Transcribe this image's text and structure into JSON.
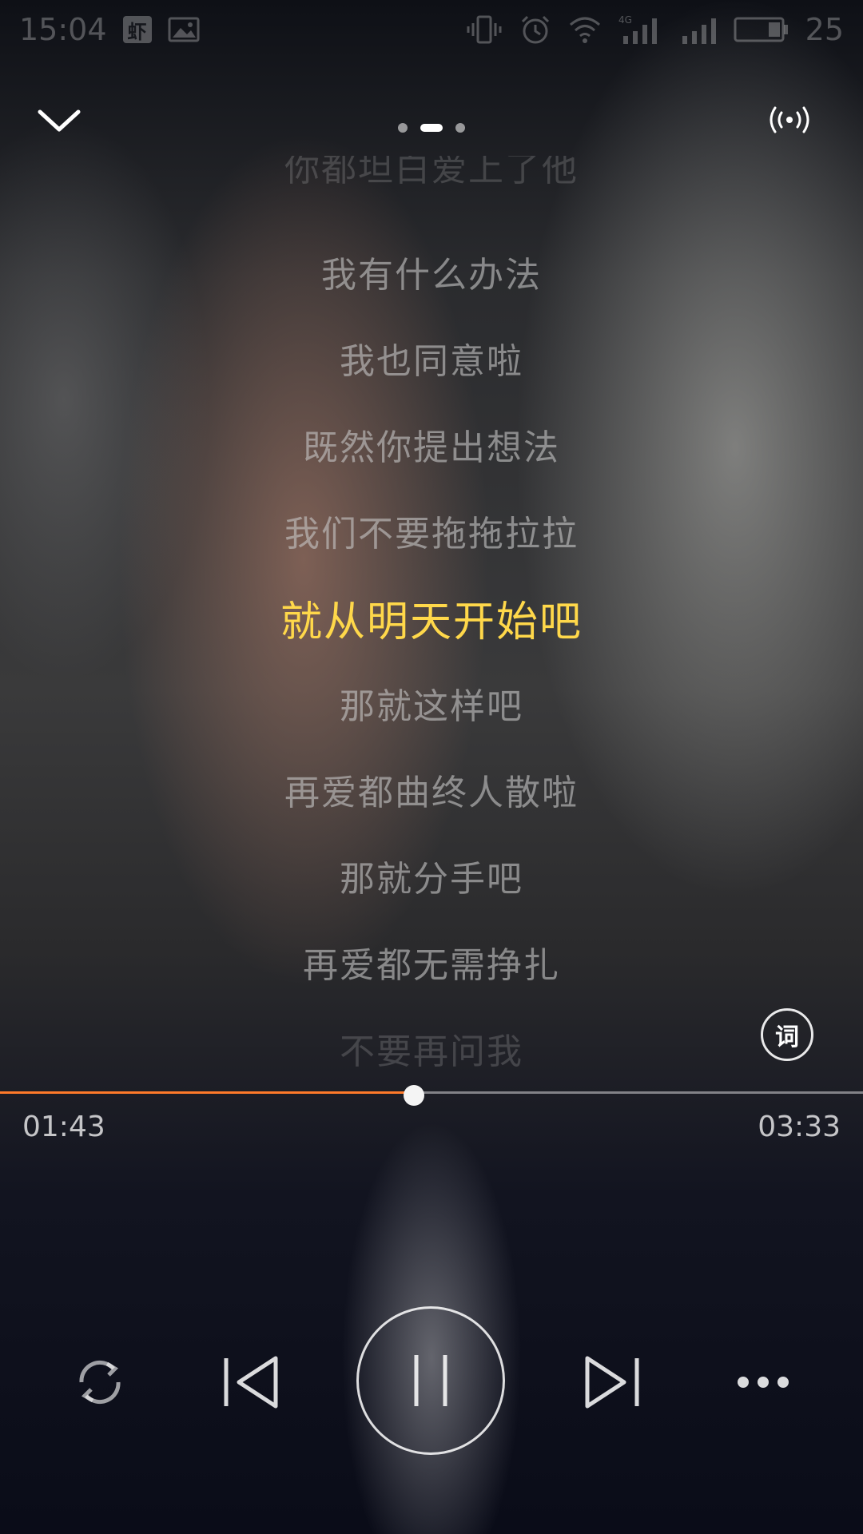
{
  "status_bar": {
    "time": "15:04",
    "app_badge": "虾",
    "battery": "25",
    "network": "4G"
  },
  "top_bar": {
    "collapse_icon": "chevron-down-icon",
    "page_dots": 3,
    "active_page": 2,
    "cast_icon": "broadcast-icon"
  },
  "lyrics": {
    "lines": [
      "你都坦白爱上了他",
      "我有什么办法",
      "我也同意啦",
      "既然你提出想法",
      "我们不要拖拖拉拉",
      "就从明天开始吧",
      "那就这样吧",
      "再爱都曲终人散啦",
      "那就分手吧",
      "再爱都无需挣扎",
      "不要再问我"
    ],
    "active_index": 5,
    "lyric_toggle_label": "词"
  },
  "player": {
    "elapsed": "01:43",
    "total": "03:33",
    "progress": 0.48,
    "accent_color": "#ff7a2a",
    "active_lyric_color": "#ffd84a"
  },
  "controls": {
    "repeat_icon": "repeat-icon",
    "prev_icon": "skip-previous-icon",
    "pause_icon": "pause-icon",
    "next_icon": "skip-next-icon",
    "more_icon": "more-icon"
  }
}
